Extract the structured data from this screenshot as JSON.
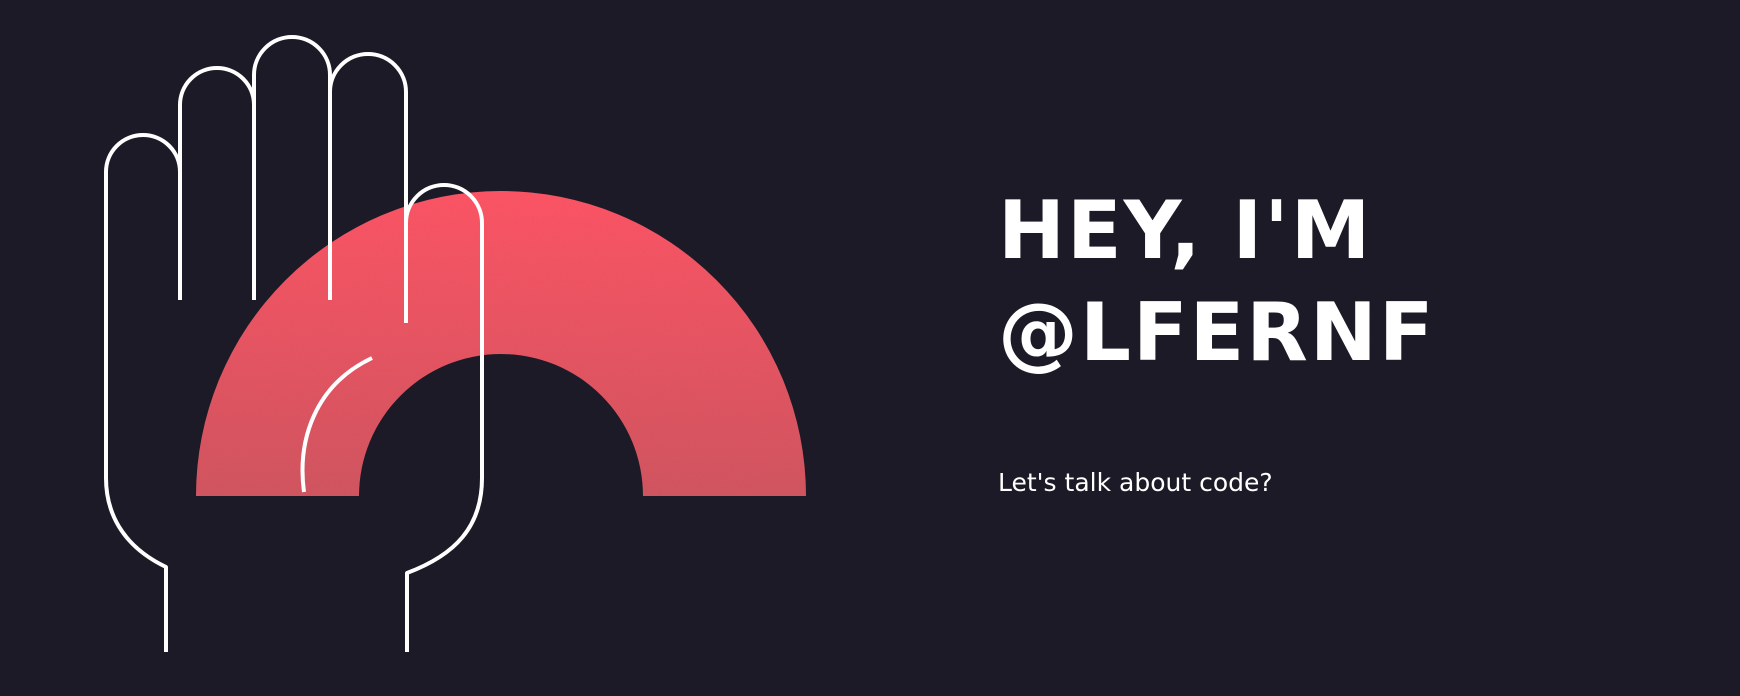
{
  "headline": {
    "line1": "HEY, I'M",
    "line2": "@LFERNF"
  },
  "tagline": "Let's talk about code?",
  "illustration": {
    "hand_icon": "raised-hand-outline-icon",
    "arc_icon": "half-ring-arc-icon"
  },
  "colors": {
    "background": "#1c1a26",
    "arc_top": "#ff5566",
    "arc_bottom": "#d35661",
    "line": "#ffffff",
    "text": "#ffffff"
  }
}
